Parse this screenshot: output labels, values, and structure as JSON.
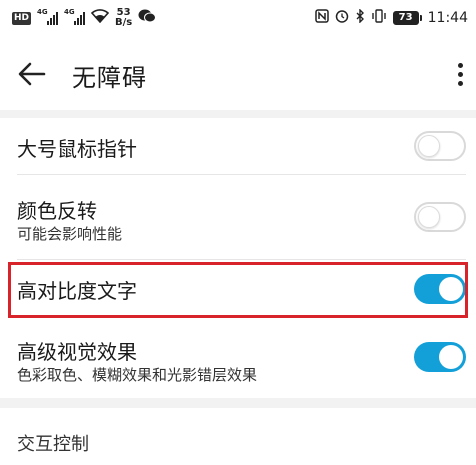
{
  "status_bar": {
    "hd": "HD",
    "net1": "4G",
    "net2": "4G",
    "speed_value": "53",
    "speed_unit": "B/s",
    "battery": "73",
    "time": "11:44"
  },
  "header": {
    "title": "无障碍"
  },
  "settings": [
    {
      "title": "大号鼠标指针",
      "subtitle": "",
      "enabled": false
    },
    {
      "title": "颜色反转",
      "subtitle": "可能会影响性能",
      "enabled": false
    },
    {
      "title": "高对比度文字",
      "subtitle": "",
      "enabled": true
    },
    {
      "title": "高级视觉效果",
      "subtitle": "色彩取色、模糊效果和光影错层效果",
      "enabled": true
    }
  ],
  "next_section": {
    "title": "交互控制"
  },
  "colors": {
    "accent": "#13a0d8",
    "highlight": "#d8232a"
  }
}
